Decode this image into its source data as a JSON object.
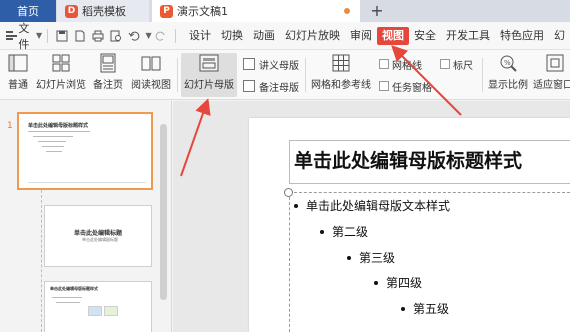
{
  "tabs": {
    "home": "首页",
    "template": "稻壳模板",
    "document": "演示文稿1",
    "new_tab": "+"
  },
  "menubar": {
    "file": "文件",
    "items": [
      "设计",
      "切换",
      "动画",
      "幻灯片放映",
      "审阅",
      "视图",
      "安全",
      "开发工具",
      "特色应用",
      "幻"
    ],
    "active_index": 5
  },
  "ribbon": {
    "normal": "普通",
    "slide_browse": "幻灯片浏览",
    "notes_page": "备注页",
    "reading_view": "阅读视图",
    "slide_master": "幻灯片母版",
    "handout_master": "讲义母版",
    "notes_master": "备注母版",
    "grid_guides": "网格和参考线",
    "gridlines": "网格线",
    "ruler": "标尺",
    "task_pane": "任务窗格",
    "zoom_ratio": "显示比例",
    "fit_window": "适应窗口"
  },
  "slide_panel": {
    "slide_number": "1",
    "thumb1_title": "单击此处编辑母版标题样式",
    "thumb2_title": "单击此处编辑标题",
    "thumb2_subtitle": "单击此处编辑副标题",
    "thumb3_title": "单击此处编辑母版标题样式"
  },
  "slide": {
    "title": "单击此处编辑母版标题样式",
    "levels": [
      "单击此处编辑母版文本样式",
      "第二级",
      "第三级",
      "第四级",
      "第五级"
    ]
  },
  "colors": {
    "accent_red": "#e5473d",
    "tab_blue": "#2f5ea8",
    "selected_orange": "#f09a4d"
  }
}
